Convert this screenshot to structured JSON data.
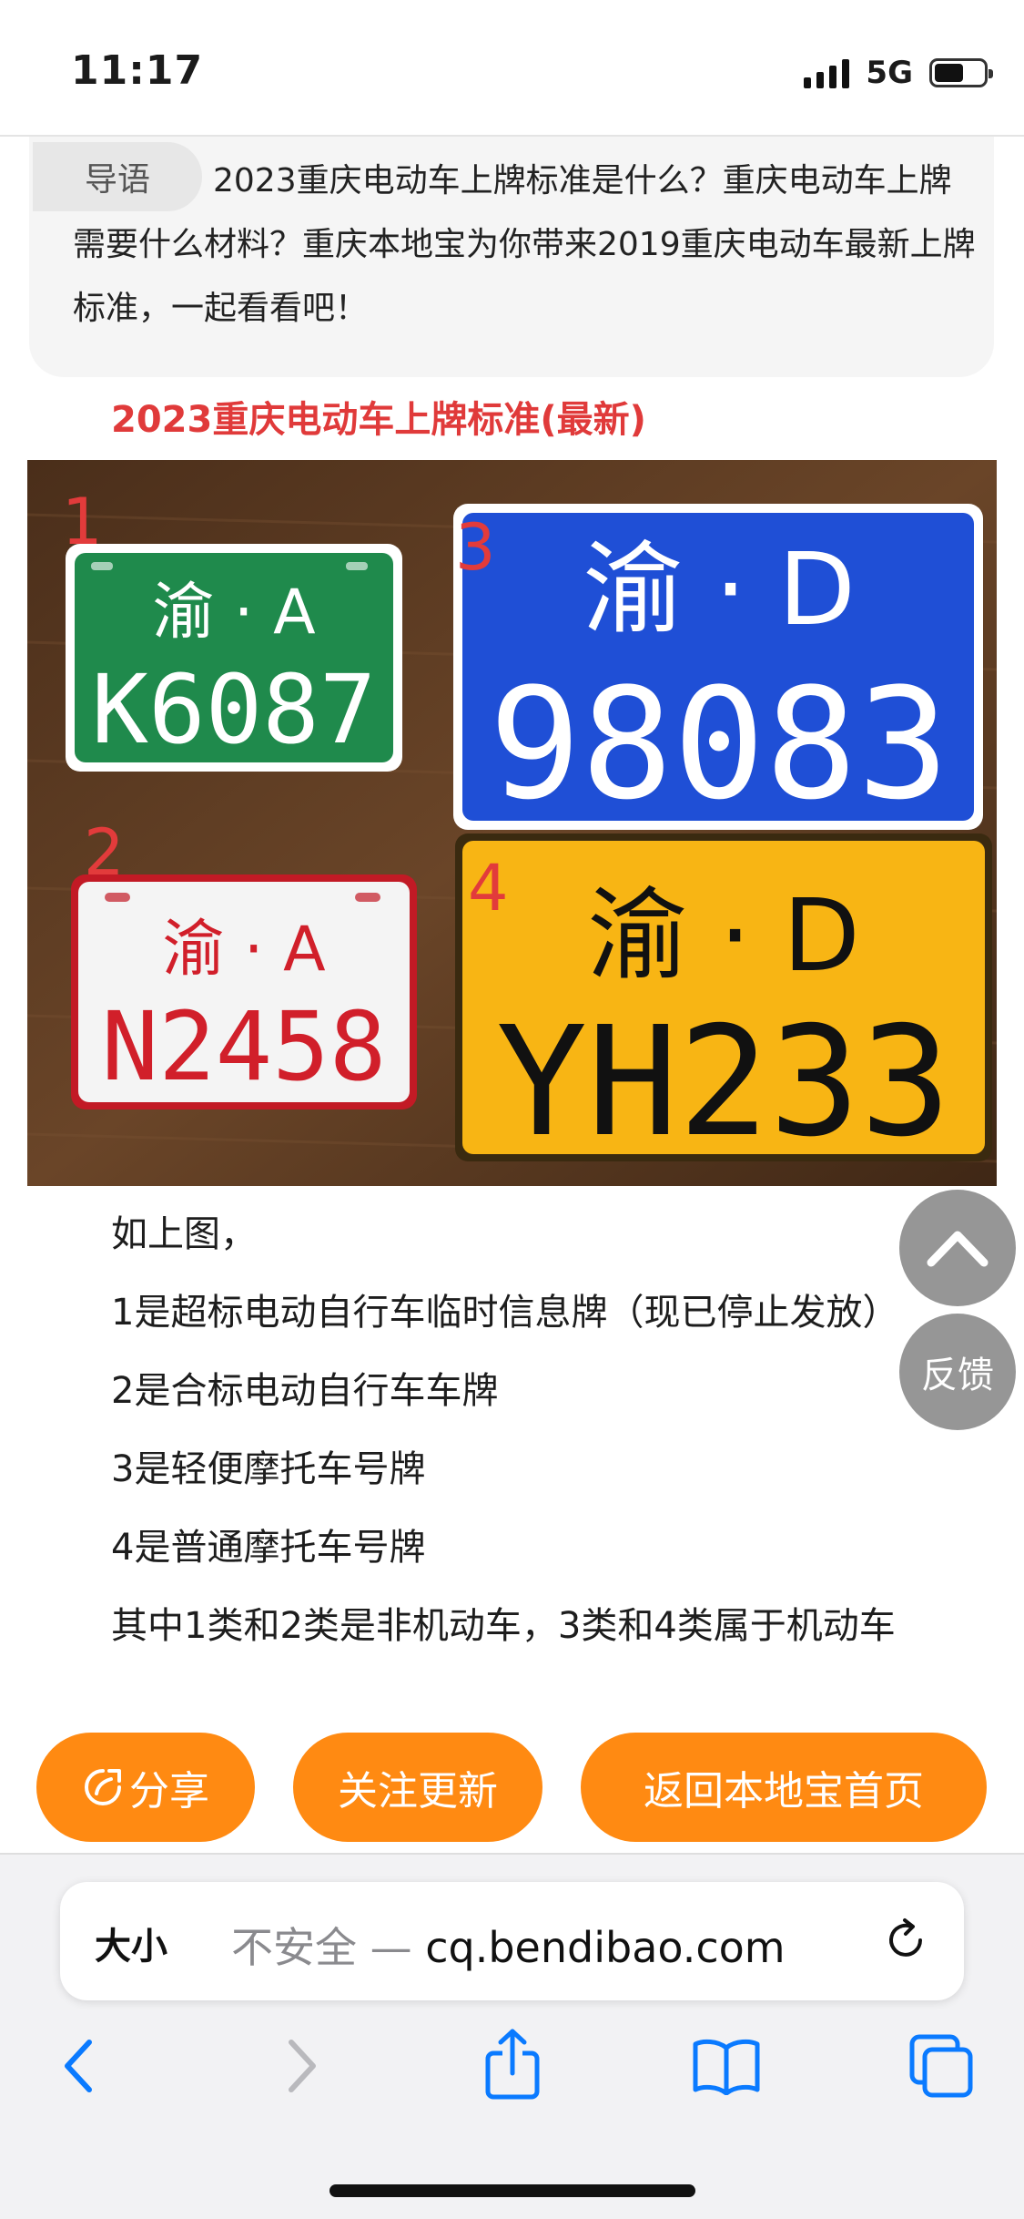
{
  "status_bar": {
    "time": "11:17",
    "network": "5G",
    "battery_level": 0.6,
    "signal_bars": 4
  },
  "intro": {
    "tag": "导语",
    "text": "2023重庆电动车上牌标准是什么？重庆电动车上牌需要什么材料？重庆本地宝为你带来2019重庆电动车最新上牌标准，一起看看吧！"
  },
  "article": {
    "subtitle": "2023重庆电动车上牌标准(最新)",
    "photo": {
      "plates": [
        {
          "number": "1",
          "top_line": "渝 · A",
          "bottom_line": "K6087",
          "color": "#1f8a4c",
          "text_color": "#ffffff"
        },
        {
          "number": "2",
          "top_line": "渝 · A",
          "bottom_line": "N2458",
          "color": "#f4f4f4",
          "text_color": "#d11f2a"
        },
        {
          "number": "3",
          "top_line": "渝 · D",
          "bottom_line": "98083",
          "color": "#1f4fd6",
          "text_color": "#ffffff"
        },
        {
          "number": "4",
          "top_line": "渝 · D",
          "bottom_line": "YH233",
          "color": "#f8b514",
          "text_color": "#111111"
        }
      ]
    },
    "lines": [
      "如上图，",
      "1是超标电动自行车临时信息牌（现已停止发放）",
      "2是合标电动自行车车牌",
      "3是轻便摩托车号牌",
      "4是普通摩托车号牌",
      "其中1类和2类是非机动车，3类和4类属于机动车"
    ]
  },
  "floating": {
    "up_icon": "chevron-up-icon",
    "feedback": "反馈"
  },
  "actions": {
    "share": "分享",
    "follow": "关注更新",
    "home": "返回本地宝首页"
  },
  "browser": {
    "text_size": "大小",
    "insecure_label": "不安全 —",
    "domain": "cq.bendibao.com",
    "icons": [
      "back-icon",
      "forward-icon",
      "share-icon",
      "bookmarks-icon",
      "tabs-icon",
      "reload-icon"
    ]
  },
  "colors": {
    "accent_orange": "#ff8a12",
    "subtitle_red": "#e03a3a",
    "ios_blue": "#0a7aff"
  }
}
